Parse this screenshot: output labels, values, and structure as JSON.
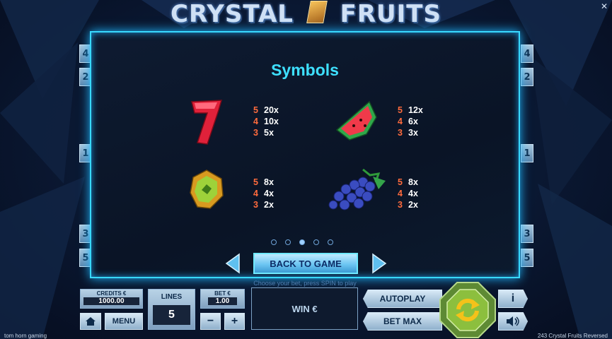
{
  "game": {
    "title_left": "CRYSTAL",
    "title_right": "FRUITS",
    "close_glyph": "✕",
    "side_numbers_left": [
      "4",
      "2",
      "1",
      "3",
      "5"
    ],
    "side_numbers_right": [
      "4",
      "2",
      "1",
      "3",
      "5"
    ]
  },
  "panel": {
    "heading": "Symbols",
    "symbols": [
      {
        "name": "seven",
        "pays": [
          {
            "count": "5",
            "mult": "20x"
          },
          {
            "count": "4",
            "mult": "10x"
          },
          {
            "count": "3",
            "mult": "5x"
          }
        ]
      },
      {
        "name": "watermelon",
        "pays": [
          {
            "count": "5",
            "mult": "12x"
          },
          {
            "count": "4",
            "mult": "6x"
          },
          {
            "count": "3",
            "mult": "3x"
          }
        ]
      },
      {
        "name": "kiwi",
        "pays": [
          {
            "count": "5",
            "mult": "8x"
          },
          {
            "count": "4",
            "mult": "4x"
          },
          {
            "count": "3",
            "mult": "2x"
          }
        ]
      },
      {
        "name": "grapes",
        "pays": [
          {
            "count": "5",
            "mult": "8x"
          },
          {
            "count": "4",
            "mult": "4x"
          },
          {
            "count": "3",
            "mult": "2x"
          }
        ]
      }
    ],
    "page_count": 5,
    "active_page": 3,
    "back_label": "BACK TO GAME"
  },
  "controls": {
    "hint": "Choose your bet, press SPIN to play",
    "credits_label": "CREDITS €",
    "credits_value": "1000.00",
    "lines_label": "LINES",
    "lines_value": "5",
    "bet_label": "BET €",
    "bet_value": "1.00",
    "menu_label": "MENU",
    "minus_label": "−",
    "plus_label": "+",
    "win_label": "WIN €",
    "autoplay_label": "AUTOPLAY",
    "betmax_label": "BET MAX",
    "info_label": "i"
  },
  "footer": {
    "left": "tom horn gaming",
    "right": "243 Crystal Fruits Reversed"
  },
  "colors": {
    "accent": "#38d9ff",
    "pay_count": "#ff6b3d"
  }
}
